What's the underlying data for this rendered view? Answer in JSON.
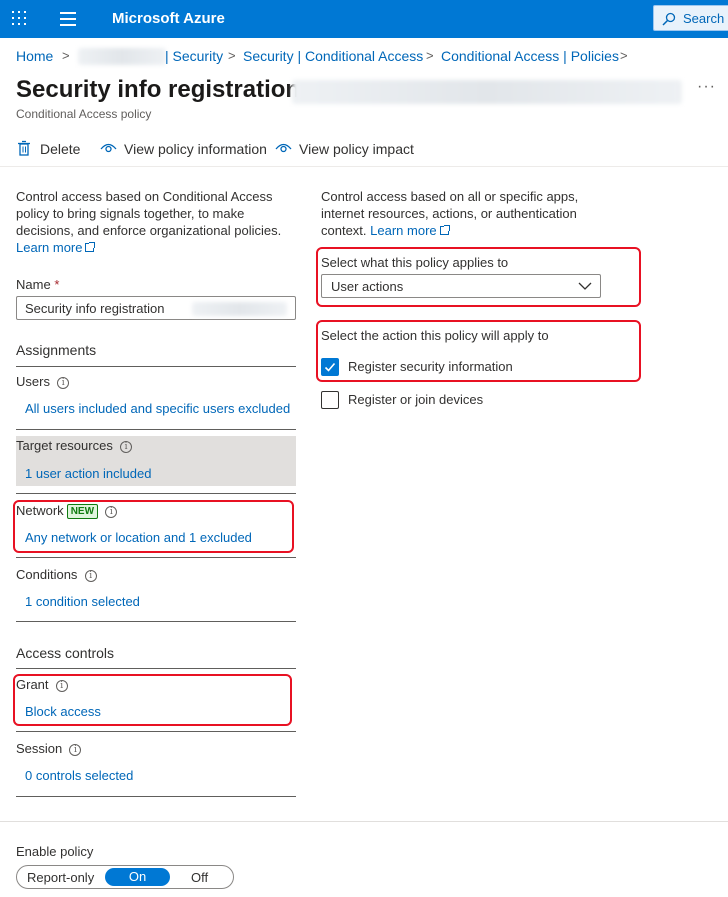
{
  "topbar": {
    "brand": "Microsoft Azure",
    "search_placeholder": "Search r"
  },
  "breadcrumb": {
    "home": "Home",
    "sep": ">",
    "security": "| Security",
    "security_ca": "Security | Conditional Access",
    "ca_policies": "Conditional Access | Policies"
  },
  "page": {
    "title": "Security info registration",
    "subtitle": "Conditional Access policy",
    "more": "···"
  },
  "toolbar": {
    "delete": "Delete",
    "view_info": "View policy information",
    "view_impact": "View policy impact"
  },
  "left": {
    "intro": "Control access based on Conditional Access policy to bring signals together, to make decisions, and enforce organizational policies.",
    "learn_more": "Learn more",
    "name_label": "Name",
    "required": "*",
    "name_value": "Security info registration",
    "assignments": "Assignments",
    "users_label": "Users",
    "users_value": "All users included and specific users excluded",
    "target_label": "Target resources",
    "target_value": "1 user action included",
    "network_label": "Network",
    "network_badge": "NEW",
    "network_value": "Any network or location and 1 excluded",
    "conditions_label": "Conditions",
    "conditions_value": "1 condition selected",
    "access_controls": "Access controls",
    "grant_label": "Grant",
    "grant_value": "Block access",
    "session_label": "Session",
    "session_value": "0 controls selected",
    "info_glyph": "i"
  },
  "right": {
    "intro": "Control access based on all or specific apps, internet resources, actions, or authentication context.",
    "learn_more": "Learn more",
    "applies_label": "Select what this policy applies to",
    "applies_value": "User actions",
    "action_label": "Select the action this policy will apply to",
    "actions": [
      {
        "label": "Register security information",
        "checked": true
      },
      {
        "label": "Register or join devices",
        "checked": false
      }
    ]
  },
  "enable_policy": {
    "label": "Enable policy",
    "options": [
      "Report-only",
      "On",
      "Off"
    ],
    "selected": "On"
  },
  "colors": {
    "accent": "#0078d4",
    "link": "#0067b8",
    "highlight": "#e81123"
  }
}
